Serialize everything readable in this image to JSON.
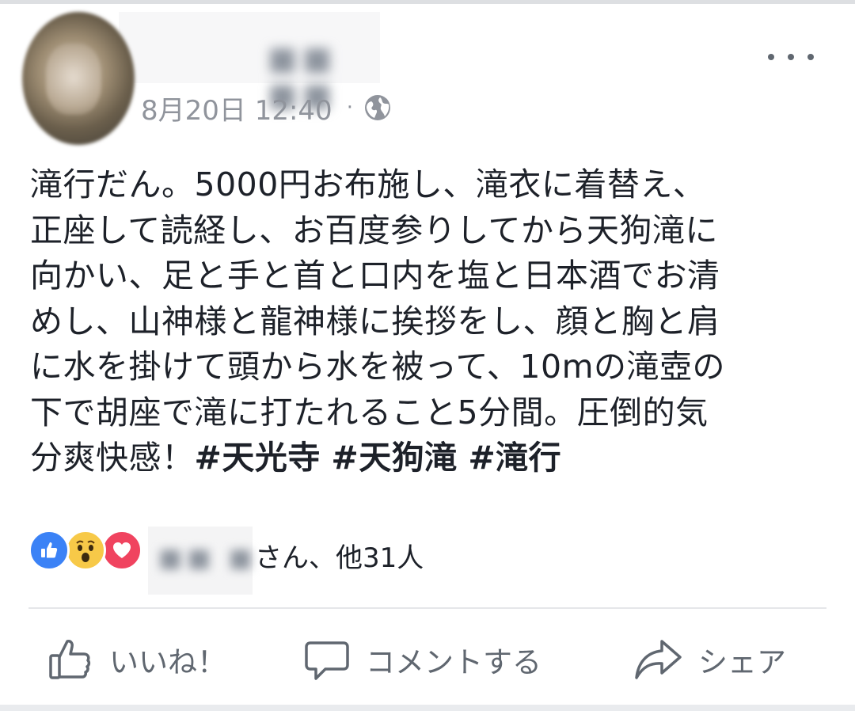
{
  "header": {
    "author_name": "■■ ■■",
    "date": "8月20日 12:40",
    "separator": "·",
    "privacy_icon": "globe-icon",
    "more_icon": "more-options-icon"
  },
  "post": {
    "lines": [
      "滝行だん。5000円お布施し、滝衣に着替え、",
      "正座して読経し、お百度参りしてから天狗滝に",
      "向かい、足と手と首と口内を塩と日本酒でお清",
      "めし、山神様と龍神様に挨拶をし、顔と胸と肩",
      "に水を掛けて頭から水を被って、10mの滝壺の",
      "下で胡座で滝に打たれること5分間。圧倒的気"
    ],
    "last_line_text": "分爽快感！",
    "hashtags": [
      "#天光寺",
      "#天狗滝",
      "#滝行"
    ]
  },
  "reactions": {
    "icons": [
      "like-reaction-icon",
      "wow-reaction-icon",
      "love-reaction-icon"
    ],
    "reactor_name": "■■ ■",
    "summary": "さん、他31人"
  },
  "actions": {
    "like_label": "いいね！",
    "comment_label": "コメントする",
    "share_label": "シェア"
  },
  "colors": {
    "text": "#1d2129",
    "secondary": "#90949c",
    "like_blue": "#3b82f6",
    "love_red": "#f0435f",
    "wow_yellow": "#f7c948"
  }
}
